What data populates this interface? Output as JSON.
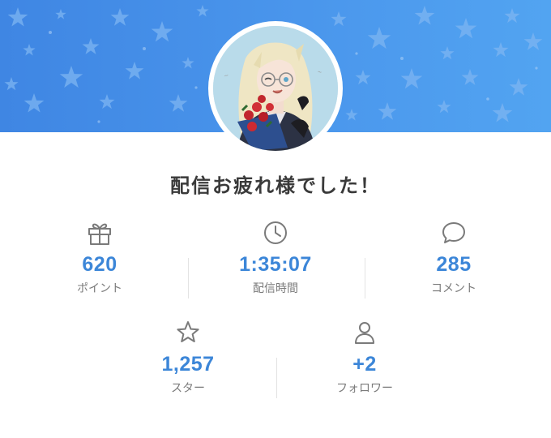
{
  "title": "配信お疲れ様でした！",
  "colors": {
    "banner": "#4a96ec",
    "value": "#3c86d8",
    "icon": "#7a7a7a"
  },
  "avatar": {
    "icon": "avatar-illustration"
  },
  "stats": [
    {
      "icon": "gift-icon",
      "value": "620",
      "label": "ポイント"
    },
    {
      "icon": "clock-icon",
      "value": "1:35:07",
      "label": "配信時間"
    },
    {
      "icon": "comment-icon",
      "value": "285",
      "label": "コメント"
    },
    {
      "icon": "star-icon",
      "value": "1,257",
      "label": "スター"
    },
    {
      "icon": "user-icon",
      "value": "+2",
      "label": "フォロワー"
    }
  ]
}
